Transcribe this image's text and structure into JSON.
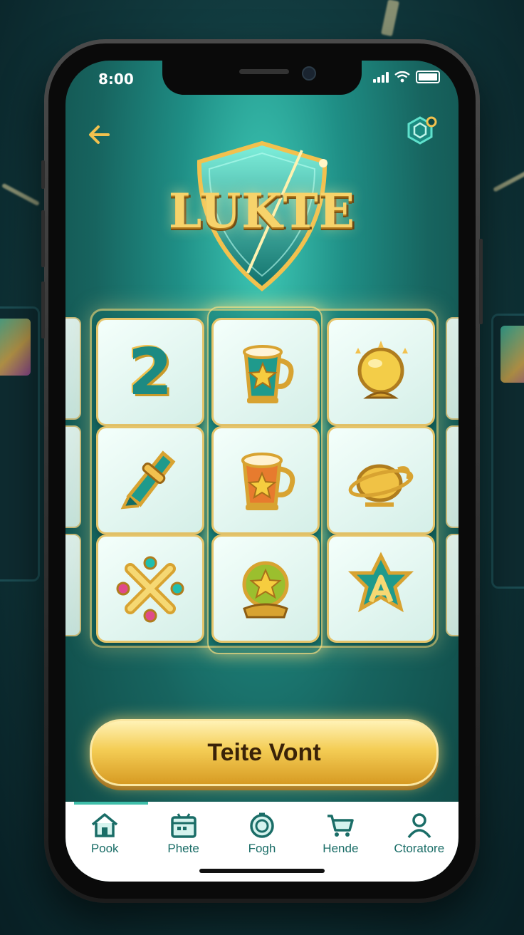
{
  "status_bar": {
    "time": "8:00"
  },
  "header": {
    "logo_text": "LUKTE"
  },
  "board": {
    "tiles": [
      {
        "row": 1,
        "col": 1,
        "icon": "number-two-icon",
        "text": "2"
      },
      {
        "row": 1,
        "col": 2,
        "icon": "mug-star-icon"
      },
      {
        "row": 1,
        "col": 3,
        "icon": "golden-orb-icon"
      },
      {
        "row": 2,
        "col": 1,
        "icon": "scroll-icon"
      },
      {
        "row": 2,
        "col": 2,
        "icon": "orange-mug-star-icon"
      },
      {
        "row": 2,
        "col": 3,
        "icon": "golden-teapot-icon"
      },
      {
        "row": 3,
        "col": 1,
        "icon": "gem-cross-icon"
      },
      {
        "row": 3,
        "col": 2,
        "icon": "star-orb-icon"
      },
      {
        "row": 3,
        "col": 3,
        "icon": "star-emblem-icon"
      }
    ]
  },
  "cta": {
    "label": "Teite Vont"
  },
  "pager": {
    "count": 3,
    "active": 2
  },
  "nav": {
    "items": [
      {
        "label": "Pook",
        "icon": "home-icon"
      },
      {
        "label": "Phete",
        "icon": "calendar-icon"
      },
      {
        "label": "Fogh",
        "icon": "compass-icon"
      },
      {
        "label": "Hende",
        "icon": "cart-icon"
      },
      {
        "label": "Ctoratore",
        "icon": "profile-icon"
      }
    ]
  },
  "colors": {
    "accent": "#f2c14e",
    "primary": "#1a6d67",
    "screen_bg": "#17645f",
    "button_gold": "#f4cd55"
  }
}
